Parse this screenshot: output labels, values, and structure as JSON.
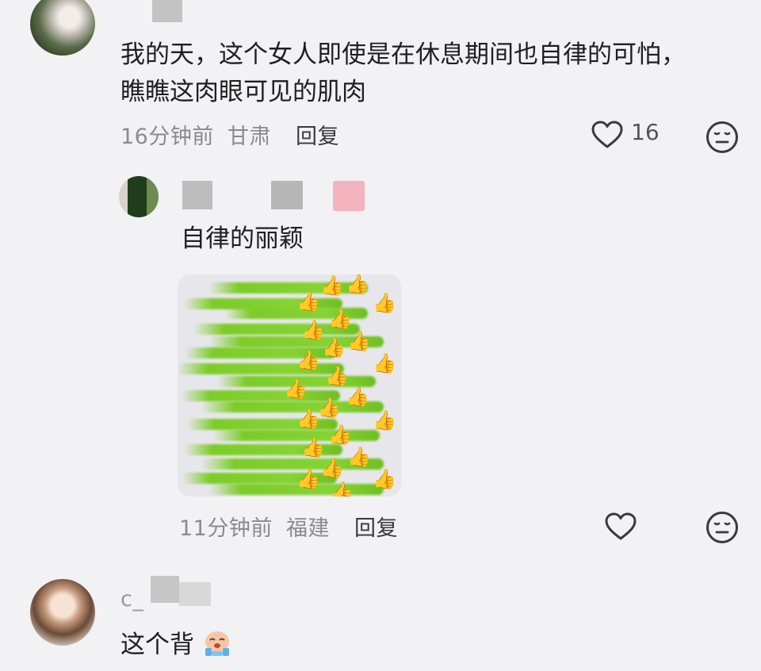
{
  "comment1": {
    "username": "",
    "text": "我的天，这个女人即使是在休息期间也自律的可怕，瞧瞧这肉眼可见的肌肉",
    "line1": "我的天，这个女人即使是在休息期间也自律的可怕，",
    "line2": "瞧瞧这肉眼可见的肌肉",
    "time": "16分钟前",
    "location": "甘肃",
    "reply_label": "回复",
    "like_count": "16"
  },
  "reply1": {
    "text": "自律的丽颖",
    "time": "11分钟前",
    "location": "福建",
    "reply_label": "回复",
    "sticker": "thumbs-up-sticker"
  },
  "comment2": {
    "username_partial": "c_",
    "text": "这个背",
    "emoji": "crying-face-emoji"
  },
  "icons": {
    "like": "heart-outline-icon",
    "dislike": "meh-face-icon"
  },
  "colors": {
    "background": "#f2f1f4",
    "meta_text": "#8b8b8b",
    "body_text": "#1f1f1f",
    "sticker_green": "#7ccc28"
  }
}
